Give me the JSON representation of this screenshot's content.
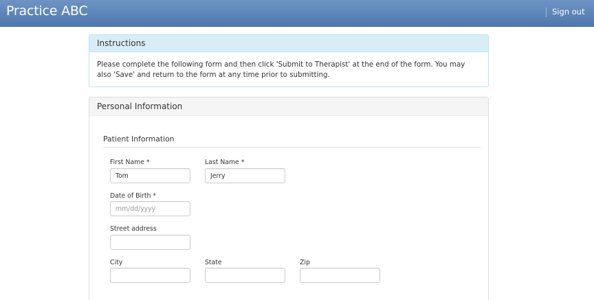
{
  "navbar": {
    "brand": "Practice ABC",
    "sign_out": "Sign out"
  },
  "instructions": {
    "heading": "Instructions",
    "text": "Please complete the following form and then click 'Submit to Therapist' at the end of the form. You may also 'Save' and return to the form at any time prior to submitting."
  },
  "personal": {
    "heading": "Personal Information",
    "section_title": "Patient Information",
    "fields": {
      "first_name": {
        "label": "First Name *",
        "value": "Tom",
        "placeholder": ""
      },
      "last_name": {
        "label": "Last Name *",
        "value": "Jerry",
        "placeholder": ""
      },
      "dob": {
        "label": "Date of Birth *",
        "value": "",
        "placeholder": "mm/dd/yyyy"
      },
      "street": {
        "label": "Street address",
        "value": "",
        "placeholder": ""
      },
      "city": {
        "label": "City",
        "value": "",
        "placeholder": ""
      },
      "state": {
        "label": "State",
        "value": "",
        "placeholder": ""
      },
      "zip": {
        "label": "Zip",
        "value": "",
        "placeholder": ""
      }
    }
  }
}
